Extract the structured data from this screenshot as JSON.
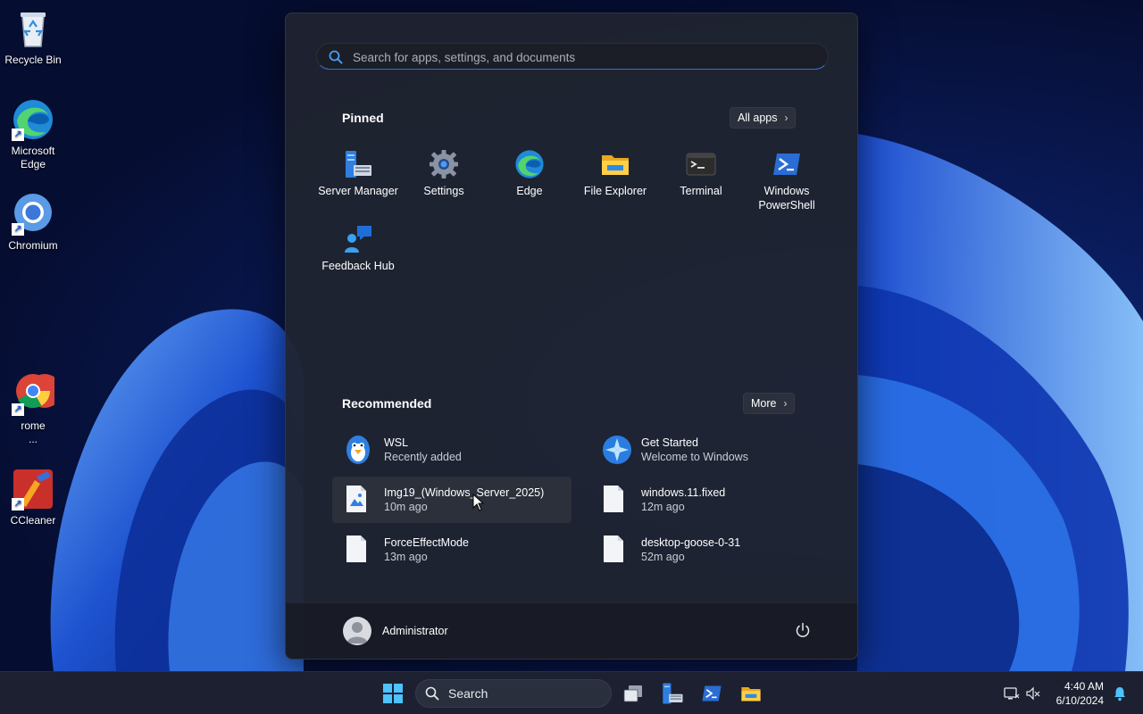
{
  "desktop": {
    "icons": [
      {
        "label": "Recycle Bin"
      },
      {
        "label": "Microsoft Edge"
      },
      {
        "label": "Chromium"
      },
      {
        "label": "rome ..."
      },
      {
        "label": "CCleaner"
      }
    ]
  },
  "start_menu": {
    "search": {
      "placeholder": "Search for apps, settings, and documents",
      "value": ""
    },
    "pinned": {
      "title": "Pinned",
      "all_apps_label": "All apps",
      "apps": [
        {
          "label": "Server Manager",
          "icon": "server-manager-icon"
        },
        {
          "label": "Settings",
          "icon": "gear-icon"
        },
        {
          "label": "Edge",
          "icon": "edge-icon"
        },
        {
          "label": "File Explorer",
          "icon": "folder-icon"
        },
        {
          "label": "Terminal",
          "icon": "terminal-icon"
        },
        {
          "label": "Windows PowerShell",
          "icon": "powershell-icon"
        },
        {
          "label": "Feedback Hub",
          "icon": "feedback-hub-icon"
        }
      ]
    },
    "recommended": {
      "title": "Recommended",
      "more_label": "More",
      "items": [
        {
          "name": "WSL",
          "sub": "Recently added",
          "icon": "penguin-icon"
        },
        {
          "name": "Get Started",
          "sub": "Welcome to Windows",
          "icon": "get-started-icon"
        },
        {
          "name": "Img19_(Windows_Server_2025)",
          "sub": "10m ago",
          "icon": "image-file-icon"
        },
        {
          "name": "windows.11.fixed",
          "sub": "12m ago",
          "icon": "file-icon"
        },
        {
          "name": "ForceEffectMode",
          "sub": "13m ago",
          "icon": "file-icon"
        },
        {
          "name": "desktop-goose-0-31",
          "sub": "52m ago",
          "icon": "file-icon"
        }
      ]
    },
    "user": {
      "name": "Administrator"
    }
  },
  "taskbar": {
    "search_label": "Search",
    "time": "4:40 AM",
    "date": "6/10/2024"
  },
  "colors": {
    "accent": "#3b82f6",
    "menu_bg": "#20242f",
    "taskbar_bg": "#1c2030"
  }
}
